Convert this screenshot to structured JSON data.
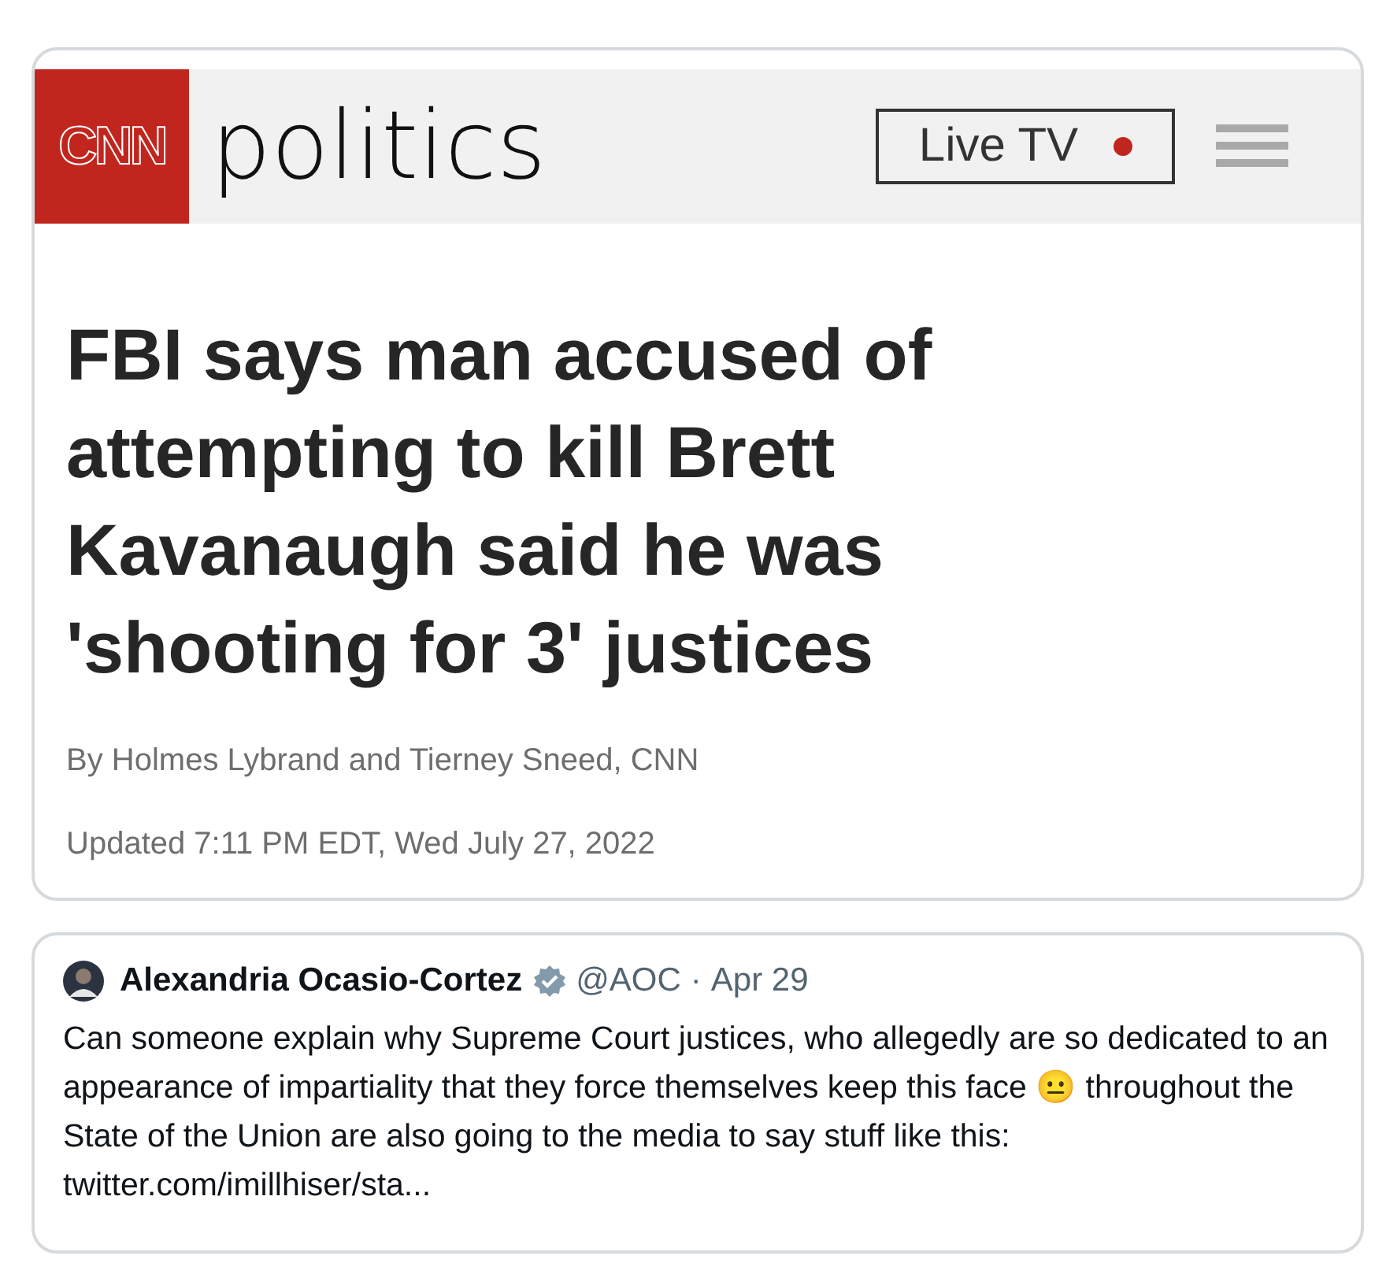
{
  "article": {
    "logo": "CNN",
    "section": "politics",
    "live_button": {
      "label": "Live TV",
      "live": true
    },
    "headline": "FBI says man accused of attempting to kill Brett Kavanaugh said he was 'shooting for 3' justices",
    "byline": "By Holmes Lybrand and Tierney Sneed, CNN",
    "updated": "Updated 7:11 PM EDT, Wed July 27, 2022"
  },
  "quote_tweet": {
    "name": "Alexandria Ocasio-Cortez",
    "verified": true,
    "handle": "@AOC",
    "separator": "·",
    "date": "Apr 29",
    "text": "Can someone explain why Supreme Court justices, who allegedly are so dedicated to an appearance of impartiality that they force themselves keep this face 😐 throughout the State of the Union are also going to the media to say stuff like this: twitter.com/imillhiser/sta..."
  }
}
